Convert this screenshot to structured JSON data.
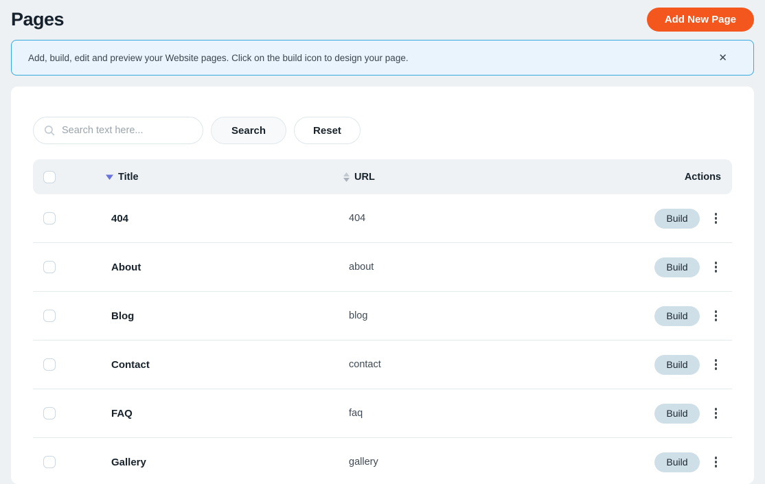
{
  "page": {
    "title": "Pages"
  },
  "header": {
    "add_button_label": "Add New Page"
  },
  "banner": {
    "message": "Add, build, edit and preview your Website pages. Click on the build icon to design your page.",
    "close_icon": "✕"
  },
  "search": {
    "placeholder": "Search text here...",
    "search_button_label": "Search",
    "reset_button_label": "Reset"
  },
  "table": {
    "columns": {
      "title": "Title",
      "url": "URL",
      "actions": "Actions"
    },
    "build_label": "Build",
    "rows": [
      {
        "title": "404",
        "url": "404"
      },
      {
        "title": "About",
        "url": "about"
      },
      {
        "title": "Blog",
        "url": "blog"
      },
      {
        "title": "Contact",
        "url": "contact"
      },
      {
        "title": "FAQ",
        "url": "faq"
      },
      {
        "title": "Gallery",
        "url": "gallery"
      }
    ]
  },
  "icons": {
    "search": "magnifier",
    "close": "x-mark",
    "title_sort": "triangle-down",
    "url_sort": "triangle-up-down",
    "row_menu": "vertical-kebab"
  },
  "colors": {
    "accent_orange": "#f4571e",
    "banner_border": "#38a9e0",
    "banner_bg": "#e9f4fc",
    "table_header_bg": "#eef2f5",
    "build_pill_bg": "#cfdfe8",
    "sort_active": "#6a73d9",
    "page_bg": "#edf1f4"
  }
}
